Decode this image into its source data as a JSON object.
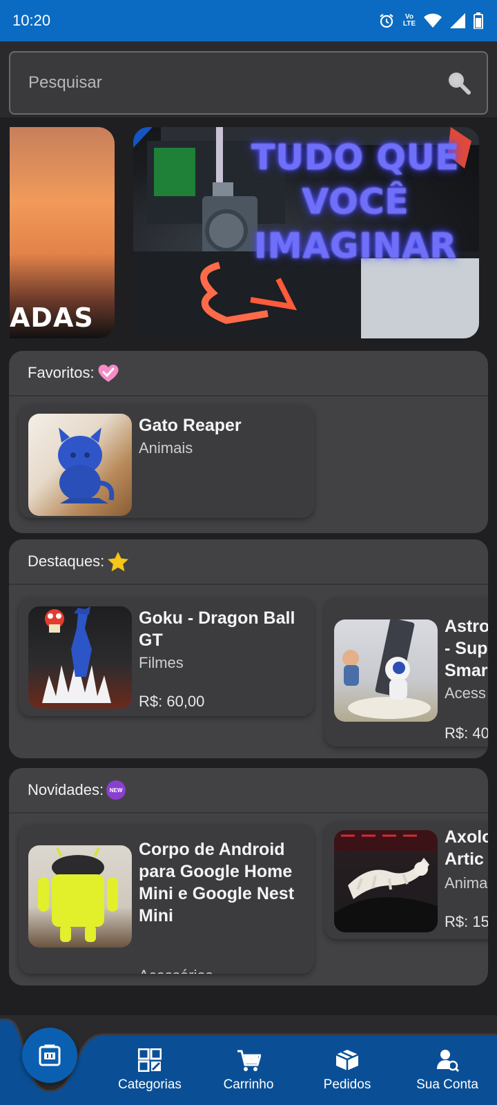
{
  "status_bar": {
    "time": "10:20",
    "volte_top": "Vo",
    "volte_bottom": "LTE"
  },
  "search": {
    "placeholder": "Pesquisar"
  },
  "banners": {
    "left_text": "ADAS",
    "main_text": "TUDO QUE VOCÊ IMAGINAR"
  },
  "sections": {
    "favoritos": {
      "title": "Favoritos:",
      "items": [
        {
          "name": "Gato Reaper",
          "category": "Animais"
        }
      ]
    },
    "destaques": {
      "title": "Destaques:",
      "items": [
        {
          "name": "Goku - Dragon Ball GT",
          "category": "Filmes",
          "price": "R$: 60,00"
        },
        {
          "name": "Astro - Sup Smar",
          "category": "Acess",
          "price": "R$: 40"
        }
      ]
    },
    "novidades": {
      "title": "Novidades:",
      "badge": "NEW",
      "items": [
        {
          "name": "Corpo de Android para Google Home Mini e Google Nest Mini",
          "category": "Acessórios"
        },
        {
          "name": "Axolo Artic",
          "category": "Anima",
          "price": "R$: 15"
        }
      ]
    }
  },
  "bottom_nav": {
    "items": [
      {
        "label": "Categorias",
        "icon": "grid-icon"
      },
      {
        "label": "Carrinho",
        "icon": "cart-icon"
      },
      {
        "label": "Pedidos",
        "icon": "box-icon"
      },
      {
        "label": "Sua Conta",
        "icon": "account-icon"
      }
    ]
  },
  "colors": {
    "status_bar": "#0b6bc2",
    "nav_bar": "#0a4f96",
    "card": "#424245",
    "background": "#1f1f22"
  }
}
